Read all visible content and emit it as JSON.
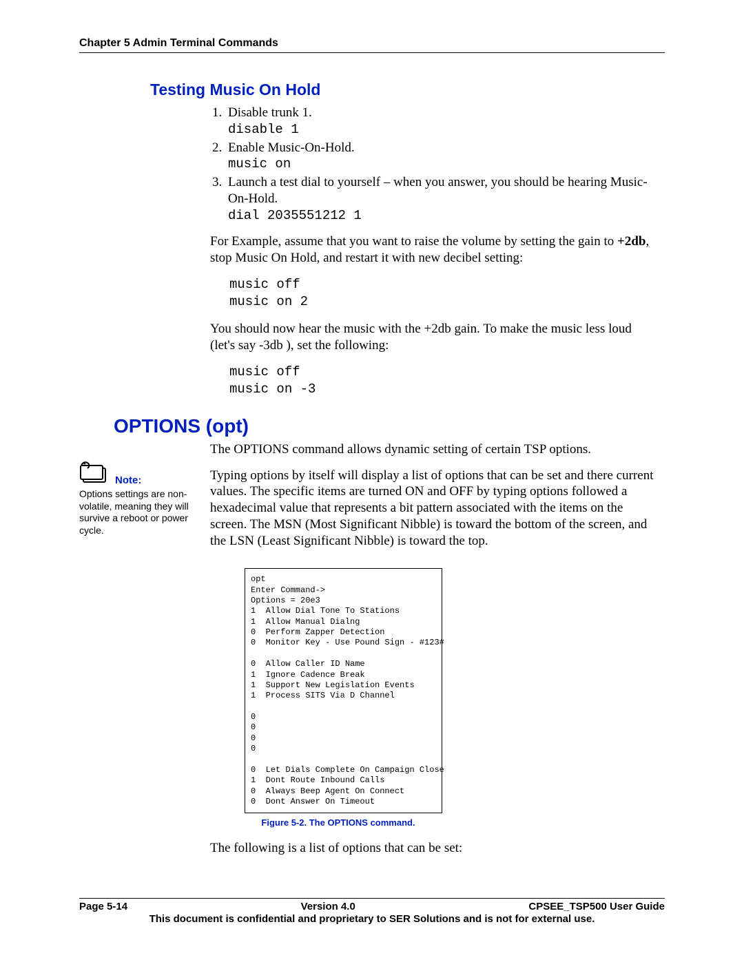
{
  "header": "Chapter 5 Admin Terminal Commands",
  "section1": {
    "title": "Testing Music On Hold",
    "steps": [
      {
        "text": "Disable trunk 1.",
        "cmd": "disable 1"
      },
      {
        "text": "Enable Music-On-Hold.",
        "cmd": "music on"
      },
      {
        "text": "Launch a test dial to yourself – when you answer, you should be hearing Music-On-Hold.",
        "cmd": "dial 2035551212 1"
      }
    ],
    "para1_a": "For Example, assume that you want to raise the volume by setting the gain to ",
    "para1_bold": "+2db",
    "para1_b": ", stop Music On Hold, and restart it with new decibel setting:",
    "code1": "music off\nmusic on 2",
    "para2": "You should now hear the music with the +2db gain. To make the music less loud (let's say -3db ), set the following:",
    "code2": "music off\nmusic on -3"
  },
  "section2": {
    "title": "OPTIONS (opt)",
    "para1": "The OPTIONS command allows dynamic setting of certain TSP options.",
    "para2": "Typing options by itself will display a list of options that can be set and there current values. The specific items are turned ON  and OFF by typing options followed a hexadecimal value that represents a bit pattern associated with the items on the screen. The MSN (Most Significant Nibble) is toward the bottom of the screen, and the LSN (Least Significant Nibble) is toward the top.",
    "note_label": "Note:",
    "note_body": "Options settings are non-volatile, meaning they will survive a reboot or power cycle.",
    "opt_output": "opt\nEnter Command->\nOptions = 20e3\n1  Allow Dial Tone To Stations\n1  Allow Manual Dialng\n0  Perform Zapper Detection\n0  Monitor Key - Use Pound Sign - #123#\n\n0  Allow Caller ID Name\n1  Ignore Cadence Break\n1  Support New Legislation Events\n1  Process SITS Via D Channel\n\n0\n0\n0\n0\n\n0  Let Dials Complete On Campaign Close\n1  Dont Route Inbound Calls\n0  Always Beep Agent On Connect\n0  Dont Answer On Timeout",
    "figure_caption": "Figure 5-2. The OPTIONS command.",
    "para3": "The following is a list of options that can be set:"
  },
  "footer": {
    "left": "Page 5-14",
    "center": "Version 4.0",
    "right": "CPSEE_TSP500 User Guide",
    "sub": "This document is confidential and proprietary to SER Solutions and is not for external use."
  }
}
